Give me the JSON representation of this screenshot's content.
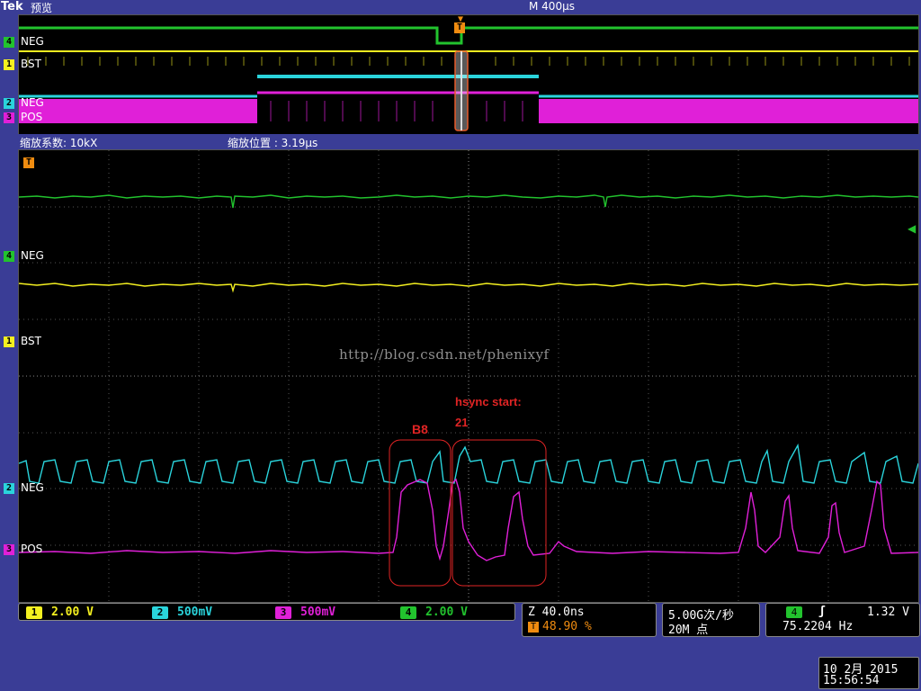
{
  "header": {
    "brand": "Tek",
    "mode": "预览",
    "timebase": "M 400μs"
  },
  "zoom": {
    "factor": "缩放系数: 10kX",
    "position": "缩放位置 :  3.19μs"
  },
  "channels": {
    "overview": [
      {
        "num": "4",
        "label": "NEG",
        "color": "#22c32e"
      },
      {
        "num": "1",
        "label": "BST",
        "color": "#f4f020"
      },
      {
        "num": "2",
        "label": "NEG",
        "color": "#2ad4dc"
      },
      {
        "num": "3",
        "label": "POS",
        "color": "#e020d8"
      }
    ],
    "main": [
      {
        "num": "4",
        "label": "NEG",
        "color": "#22c32e"
      },
      {
        "num": "1",
        "label": "BST",
        "color": "#f4f020"
      },
      {
        "num": "2",
        "label": "NEG",
        "color": "#2ad4dc"
      },
      {
        "num": "3",
        "label": "POS",
        "color": "#e020d8"
      }
    ],
    "trigger_marker": "T"
  },
  "annotations": {
    "watermark": "http://blog.csdn.net/phenixyf",
    "b8": "B8",
    "hsync": "hsync start:",
    "hsync_value": "21"
  },
  "status": {
    "scales": [
      {
        "num": "1",
        "value": "2.00 V",
        "color": "#f4f020"
      },
      {
        "num": "2",
        "value": "500mV",
        "color": "#2ad4dc"
      },
      {
        "num": "3",
        "value": "500mV",
        "color": "#e020d8"
      },
      {
        "num": "4",
        "value": "2.00 V",
        "color": "#22c32e"
      }
    ],
    "zoom_time": "Z 40.0ns",
    "trigger_position": "48.90 %",
    "sample_rate": "5.00G次/秒",
    "record_length": "20M 点",
    "trigger_channel": "4",
    "trigger_slope": "ʃ",
    "trigger_level": "1.32 V",
    "frequency": "75.2204 Hz",
    "date": "10 2月  2015",
    "time": "15:56:54"
  }
}
